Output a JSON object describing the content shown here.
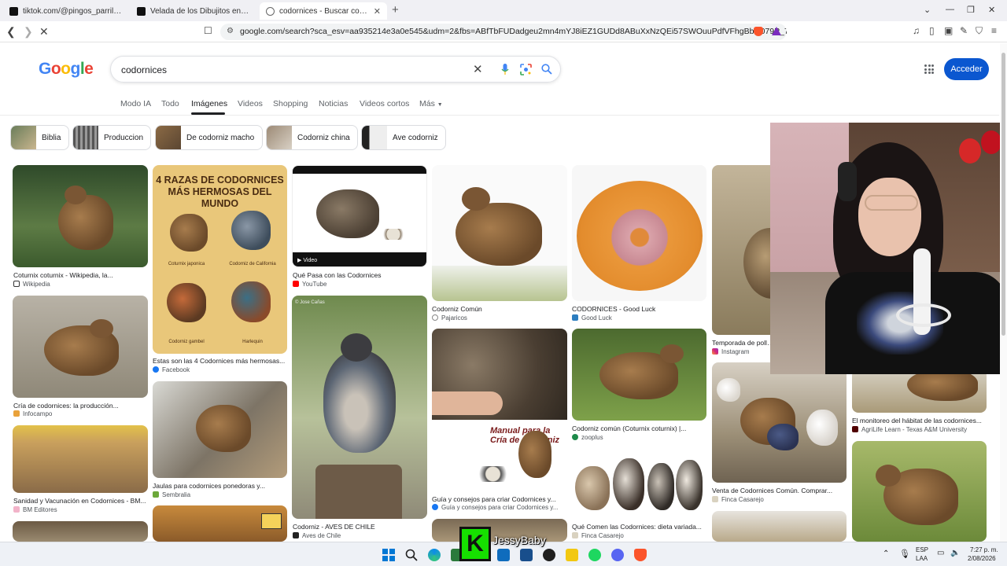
{
  "browser": {
    "tabs": [
      {
        "title": "tiktok.com/@pingos_parrilla/video/7...",
        "active": false
      },
      {
        "title": "Velada de los Dibujitos en Roblox - C...",
        "active": false
      },
      {
        "title": "codornices - Buscar con Google",
        "active": true
      }
    ],
    "url": "google.com/search?sca_esv=aa935214e3a0e545&udm=2&fbs=ABfTbFUDadgeu2mn4mYJ8iEZ1GUDd8ABuXxNzQEi57SWOuuPdfVFhgBbO079P_7XyIRUX..."
  },
  "google": {
    "logo": "Google",
    "query": "codornices",
    "signin_label": "Acceder",
    "nav": [
      "Modo IA",
      "Todo",
      "Imágenes",
      "Videos",
      "Shopping",
      "Noticias",
      "Videos cortos",
      "Más"
    ],
    "chips": [
      "Biblia",
      "Produccion",
      "De codorniz macho",
      "Codorniz china",
      "Ave codorniz"
    ],
    "results": [
      {
        "caption": "Coturnix coturnix - Wikipedia, la...",
        "source": "Wikipedia"
      },
      {
        "caption": "Cría de codornices: la producción...",
        "source": "Infocampo"
      },
      {
        "caption": "Sanidad y Vacunación en Codornices - BM...",
        "source": "BM Editores"
      },
      {
        "caption": "Estas son las 4 Codornices más hermosas...",
        "source": "Facebook"
      },
      {
        "caption": "Jaulas para codornices ponedoras y...",
        "source": "Sembralia"
      },
      {
        "caption": "Qué Pasa con las Codornices",
        "source": "YouTube"
      },
      {
        "caption": "Codorniz - AVES DE CHILE",
        "source": "Aves de Chile"
      },
      {
        "caption": "Codorniz Común",
        "source": "Pajaricos"
      },
      {
        "caption": "Guía y consejos para criar Codornices y...",
        "source": "Guía y consejos para criar Codornices y..."
      },
      {
        "caption": "CODORNICES - Good Luck",
        "source": "Good Luck"
      },
      {
        "caption": "Codorniz común (Coturnix coturnix) |...",
        "source": "zooplus"
      },
      {
        "caption": "Qué Comen las Codornices: dieta variada...",
        "source": "Finca Casarejo"
      },
      {
        "caption": "Temporada de pollu...",
        "source": "Instagram"
      },
      {
        "caption": "Venta de Codornices Común. Comprar...",
        "source": "Finca Casarejo"
      },
      {
        "caption": "El monitoreo del hábitat de las codornices...",
        "source": "AgriLife Learn - Texas A&M University"
      }
    ],
    "poster": {
      "title_line1": "4 RAZAS DE CODORNICES",
      "title_line2": "MÁS HERMOSAS DEL MUNDO",
      "labels": [
        "Coturnix japonica",
        "Codorniz de California",
        "Codorniz gambel",
        "Harlequin"
      ]
    },
    "video_badge": "Video",
    "watermark": "© Jose Cañas",
    "manual_text": "Manual para la Cría de Codorniz"
  },
  "overlay": {
    "stream_name": "JessyBaby"
  },
  "taskbar": {
    "lang1": "ESP",
    "lang2": "LAA",
    "time": "7:27 p. m.",
    "date": "2/08/2026"
  },
  "colors": {
    "accent": "#0b57d0",
    "g_blue": "#4285f4",
    "g_red": "#ea4335",
    "g_yellow": "#fbbc05",
    "g_green": "#34a853"
  }
}
